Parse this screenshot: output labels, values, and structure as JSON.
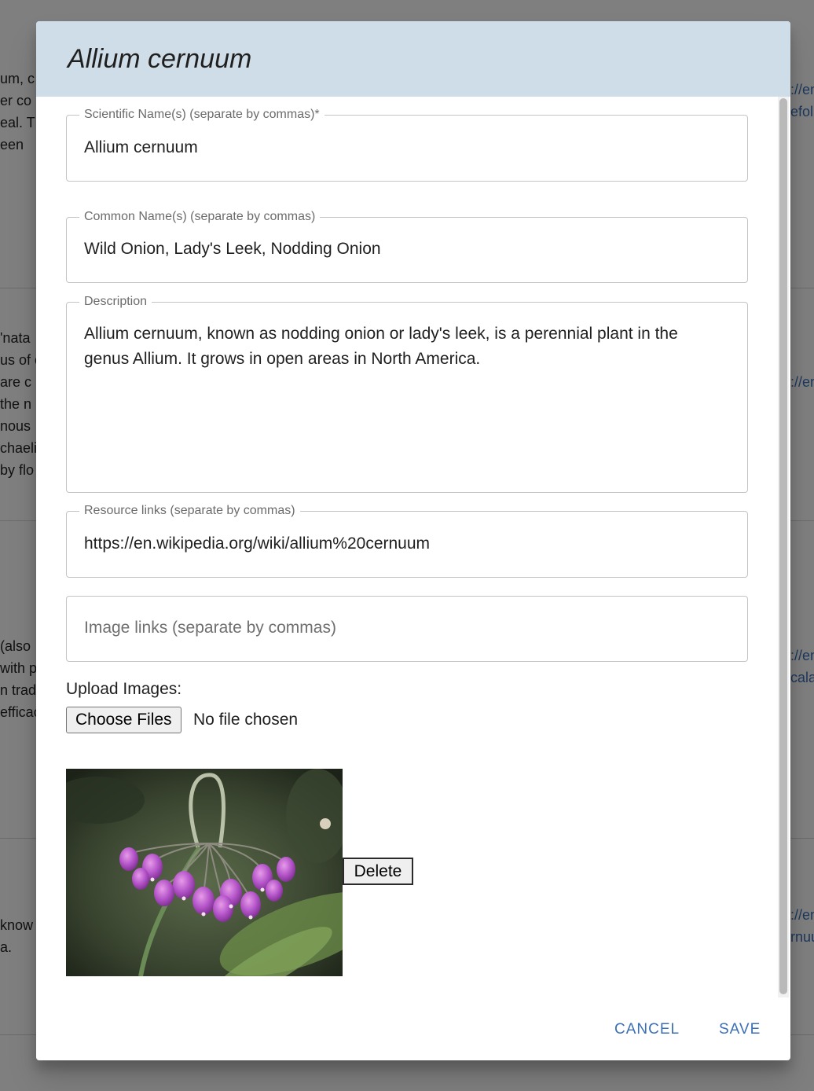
{
  "background": {
    "left_text": [
      "um, c",
      "er co",
      "eal. T",
      "een",
      "'nata",
      "us of c",
      " are c",
      " the n",
      "nous",
      "chaeli",
      "by flo",
      " (also",
      "with p",
      "n trad",
      "efficac",
      " know",
      "a."
    ],
    "right_links": [
      "://en",
      "efol",
      "://en",
      "://en",
      "cala",
      "://en",
      "rnuu"
    ]
  },
  "modal": {
    "title": "Allium cernuum",
    "fields": {
      "scientific": {
        "label": "Scientific Name(s) (separate by commas)*",
        "value": "Allium cernuum"
      },
      "common": {
        "label": "Common Name(s) (separate by commas)",
        "value": "Wild Onion, Lady's Leek, Nodding Onion"
      },
      "description": {
        "label": "Description",
        "value": "Allium cernuum, known as nodding onion or lady's leek, is a perennial plant in the genus Allium. It grows in open areas in North America."
      },
      "resources": {
        "label": "Resource links (separate by commas)",
        "value": "https://en.wikipedia.org/wiki/allium%20cernuum"
      },
      "images": {
        "placeholder": "Image links (separate by commas)"
      }
    },
    "upload": {
      "label": "Upload Images:",
      "button": "Choose Files",
      "status": "No file chosen"
    },
    "image_delete_label": "Delete",
    "footer": {
      "cancel": "CANCEL",
      "save": "SAVE"
    },
    "colors": {
      "header_bg": "#cfdde8",
      "accent": "#3b6fb6",
      "flower": "#b455c9"
    }
  }
}
